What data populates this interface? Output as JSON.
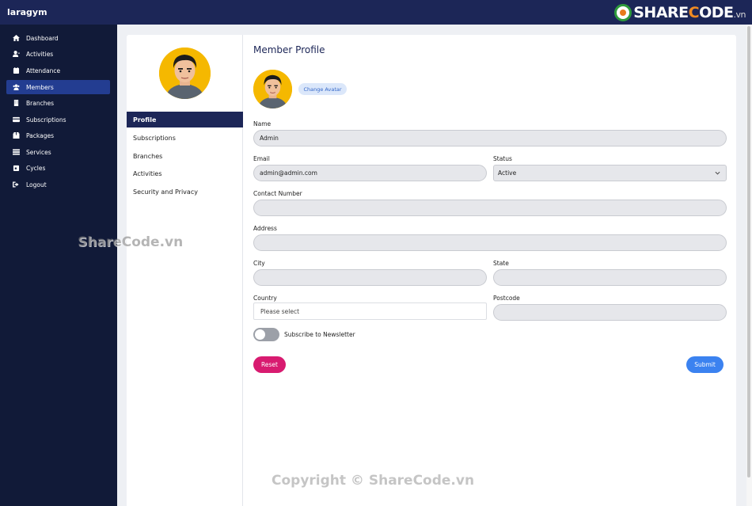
{
  "app": {
    "brand": "laragym"
  },
  "logo": {
    "text_main": "SHARE",
    "text_o": "C",
    "text_rest": "ODE",
    "text_vn": ".vn"
  },
  "sidebar": {
    "items": [
      {
        "label": "Dashboard",
        "icon": "home-icon",
        "active": false
      },
      {
        "label": "Activities",
        "icon": "user-activity-icon",
        "active": false
      },
      {
        "label": "Attendance",
        "icon": "calendar-icon",
        "active": false
      },
      {
        "label": "Members",
        "icon": "users-icon",
        "active": true
      },
      {
        "label": "Branches",
        "icon": "building-icon",
        "active": false
      },
      {
        "label": "Subscriptions",
        "icon": "credit-card-icon",
        "active": false
      },
      {
        "label": "Packages",
        "icon": "box-icon",
        "active": false
      },
      {
        "label": "Services",
        "icon": "server-icon",
        "active": false
      },
      {
        "label": "Cycles",
        "icon": "calendar-day-icon",
        "active": false
      },
      {
        "label": "Logout",
        "icon": "sign-out-icon",
        "active": false
      }
    ]
  },
  "profile_menu": {
    "items": [
      {
        "label": "Profile",
        "active": true
      },
      {
        "label": "Subscriptions",
        "active": false
      },
      {
        "label": "Branches",
        "active": false
      },
      {
        "label": "Activities",
        "active": false
      },
      {
        "label": "Security and Privacy",
        "active": false
      }
    ]
  },
  "form": {
    "title": "Member Profile",
    "change_avatar": "Change Avatar",
    "name": {
      "label": "Name",
      "value": "Admin"
    },
    "email": {
      "label": "Email",
      "value": "admin@admin.com"
    },
    "status": {
      "label": "Status",
      "value": "Active"
    },
    "contact": {
      "label": "Contact Number",
      "value": ""
    },
    "address": {
      "label": "Address",
      "value": ""
    },
    "city": {
      "label": "City",
      "value": ""
    },
    "state": {
      "label": "State",
      "value": ""
    },
    "country": {
      "label": "Country",
      "placeholder": "Please select"
    },
    "postcode": {
      "label": "Postcode",
      "value": ""
    },
    "newsletter": {
      "label": "Subscribe to Newsletter",
      "checked": false
    },
    "reset_label": "Reset",
    "submit_label": "Submit"
  },
  "watermarks": {
    "left": "ShareCode.vn",
    "bottom": "Copyright © ShareCode.vn"
  },
  "colors": {
    "topbar": "#1c2657",
    "sidebar": "#111a38",
    "sidebar_active": "#233d91",
    "reset": "#d81b70",
    "submit": "#3b82f0"
  }
}
